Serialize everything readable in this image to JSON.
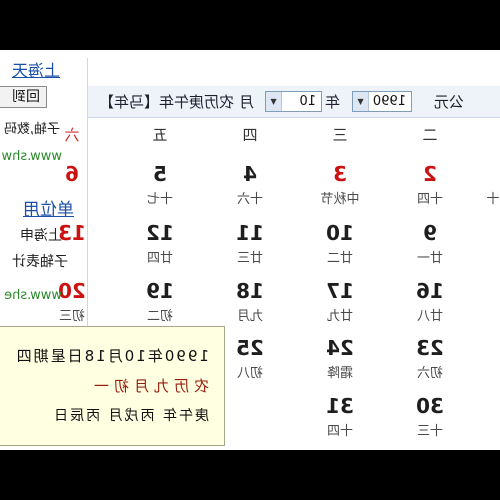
{
  "sidebar": {
    "top_link": "上海天",
    "back_button": "回到",
    "ads": [
      "子轴,数码",
      "www.shw",
      "单位用",
      "上海申",
      "子轴表计",
      "www.she"
    ]
  },
  "toolbar": {
    "era_label": "公元",
    "year_select": "1990",
    "year_label": "年",
    "month_select": "10",
    "month_label": "月",
    "lunar_year": "农历庚午年【马年】"
  },
  "weekdays": [
    {
      "label": "二",
      "weekend": false
    },
    {
      "label": "三",
      "weekend": false
    },
    {
      "label": "四",
      "weekend": false
    },
    {
      "label": "五",
      "weekend": false
    },
    {
      "label": "六",
      "weekend": true
    }
  ],
  "calendar": {
    "rows": [
      [
        {
          "dow": 1,
          "lunar": "十"
        },
        {
          "dow": 2,
          "day": "2",
          "lunar": "十四",
          "red": true
        },
        {
          "dow": 3,
          "day": "3",
          "lunar": "中秋节",
          "red": true
        },
        {
          "dow": 4,
          "day": "4",
          "lunar": "十六"
        },
        {
          "dow": 5,
          "day": "5",
          "lunar": "十七"
        },
        {
          "dow": 6,
          "day": "6",
          "red": true
        }
      ],
      [
        {
          "dow": 2,
          "day": "9",
          "lunar": "廿一"
        },
        {
          "dow": 3,
          "day": "10",
          "lunar": "廿二"
        },
        {
          "dow": 4,
          "day": "11",
          "lunar": "廿三"
        },
        {
          "dow": 5,
          "day": "12",
          "lunar": "廿四"
        },
        {
          "dow": 6,
          "day": "13",
          "red": true
        }
      ],
      [
        {
          "dow": 2,
          "day": "16",
          "lunar": "廿八"
        },
        {
          "dow": 3,
          "day": "17",
          "lunar": "廿九"
        },
        {
          "dow": 4,
          "day": "18",
          "lunar": "九月"
        },
        {
          "dow": 5,
          "day": "19",
          "lunar": "初二"
        },
        {
          "dow": 6,
          "day": "20",
          "lunar": "初三",
          "red": true
        }
      ],
      [
        {
          "dow": 2,
          "day": "23",
          "lunar": "初六"
        },
        {
          "dow": 3,
          "day": "24",
          "lunar": "霜降"
        },
        {
          "dow": 4,
          "day": "25",
          "lunar": "初八"
        }
      ],
      [
        {
          "dow": 2,
          "day": "30",
          "lunar": "十三"
        },
        {
          "dow": 3,
          "day": "31",
          "lunar": "十四"
        }
      ]
    ]
  },
  "tooltip": {
    "date_line": "1990年10月18日星期四",
    "lunar_line": "农历九月初一",
    "ganzhi_line": "庚午年 丙戌月 丙辰日"
  },
  "colors": {
    "holiday_red": "#cc1111",
    "day_text": "#1e1e1e",
    "link_blue": "#1b4fa8",
    "url_green": "#2b8a2b",
    "tooltip_bg": "#ffffe1",
    "toolbar_bg": "#eef3fa"
  },
  "icons": {
    "select_arrow": "chevron-down-icon"
  }
}
